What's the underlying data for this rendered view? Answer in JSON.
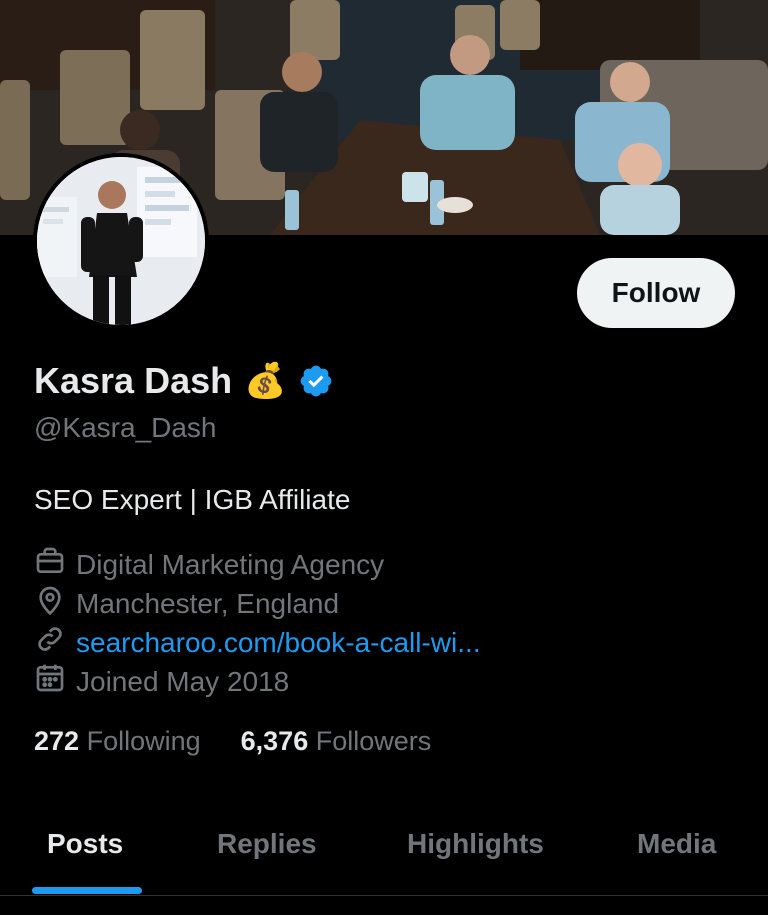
{
  "profile": {
    "name": "Kasra Dash",
    "name_emoji": "💰",
    "handle": "@Kasra_Dash",
    "bio": "SEO Expert | IGB Affiliate",
    "category": "Digital Marketing Agency",
    "location": "Manchester, England",
    "link": "searcharoo.com/book-a-call-wi...",
    "joined": "Joined May 2018"
  },
  "stats": {
    "following_count": "272",
    "following_label": "Following",
    "followers_count": "6,376",
    "followers_label": "Followers"
  },
  "actions": {
    "follow_label": "Follow"
  },
  "tabs": [
    {
      "label": "Posts",
      "active": true
    },
    {
      "label": "Replies",
      "active": false
    },
    {
      "label": "Highlights",
      "active": false
    },
    {
      "label": "Media",
      "active": false
    }
  ],
  "colors": {
    "accent": "#1d9bf0",
    "background": "#000000",
    "muted": "#71767b",
    "verified": "#1d9bf0"
  },
  "icons": [
    "verified-badge-icon",
    "briefcase-icon",
    "location-pin-icon",
    "link-icon",
    "calendar-icon"
  ]
}
